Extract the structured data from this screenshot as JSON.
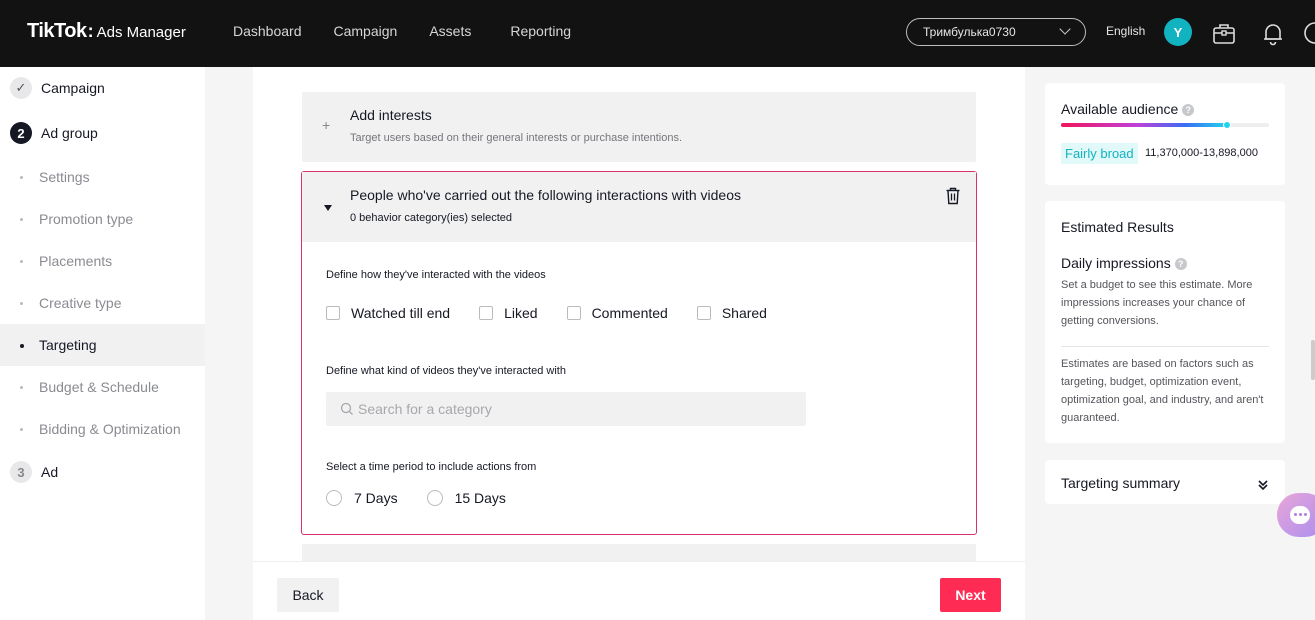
{
  "header": {
    "logo_main": "TikTok",
    "logo_colon": ":",
    "logo_sub": "Ads Manager",
    "nav": [
      "Dashboard",
      "Campaign",
      "Assets",
      "Reporting"
    ],
    "account": "Тримбулька0730",
    "language": "English",
    "avatar_initial": "Y"
  },
  "sidebar": {
    "steps": [
      {
        "number": "✓",
        "label": "Campaign"
      },
      {
        "number": "2",
        "label": "Ad group"
      },
      {
        "number": "3",
        "label": "Ad"
      }
    ],
    "subitems": [
      "Settings",
      "Promotion type",
      "Placements",
      "Creative type",
      "Targeting",
      "Budget & Schedule",
      "Bidding & Optimization"
    ],
    "active_subitem": "Targeting"
  },
  "main": {
    "interests": {
      "plus": "+",
      "title": "Add interests",
      "desc": "Target users based on their general interests or purchase intentions."
    },
    "behavior": {
      "title": "People who've carried out the following interactions with videos",
      "selected": "0 behavior category(ies) selected",
      "define_interaction_label": "Define how they've interacted with the videos",
      "interactions": [
        "Watched till end",
        "Liked",
        "Commented",
        "Shared"
      ],
      "define_kind_label": "Define what kind of videos they've interacted with",
      "search_placeholder": "Search for a category",
      "period_label": "Select a time period to include actions from",
      "periods": [
        "7 Days",
        "15 Days"
      ]
    },
    "footer": {
      "back": "Back",
      "next": "Next"
    }
  },
  "right": {
    "audience": {
      "title": "Available audience",
      "help": "?",
      "level_fraction": 0.8,
      "badge": "Fairly broad",
      "range": "11,370,000-13,898,000"
    },
    "estimated": {
      "title": "Estimated Results",
      "daily_title": "Daily impressions",
      "help": "?",
      "daily_desc": "Set a budget to see this estimate. More impressions increases your chance of getting conversions.",
      "note": "Estimates are based on factors such as targeting, budget, optimization event, optimization goal, and industry, and aren't guaranteed."
    },
    "summary": {
      "title": "Targeting summary"
    }
  },
  "colors": {
    "accent": "#fe2c55",
    "border_active": "#d9306f",
    "teal": "#12b3c1"
  }
}
